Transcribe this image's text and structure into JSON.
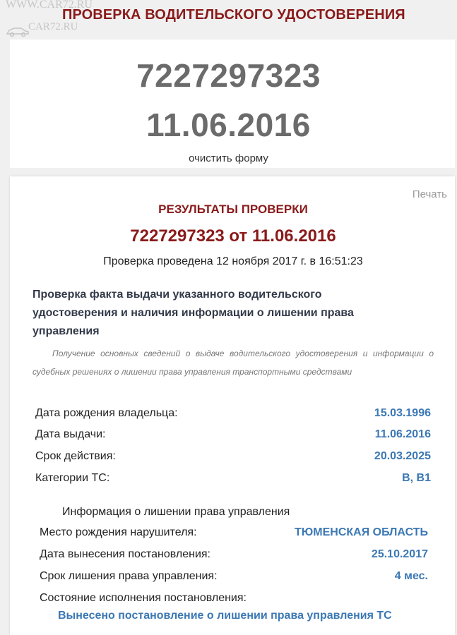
{
  "watermark": {
    "top": "WWW.CAR72.RU",
    "bottom": "CAR72.RU"
  },
  "page_title": "ПРОВЕРКА ВОДИТЕЛЬСКОГО УДОСТОВЕРЕНИЯ",
  "form": {
    "license_number": "7227297323",
    "issue_date": "11.06.2016",
    "clear_label": "очистить форму"
  },
  "results": {
    "print_label": "Печать",
    "title": "РЕЗУЛЬТАТЫ ПРОВЕРКИ",
    "subtitle": "7227297323 от 11.06.2016",
    "check_time": "Проверка проведена 12 ноября 2017 г. в 16:51:23",
    "section_title": "Проверка факта выдачи указанного водительского удостоверения и наличия информации о лишении права управления",
    "section_desc": "Получение основных сведений о выдаче водительского удостоверения и информации о судебных решениях о лишении права управления транспортными средствами",
    "fields": [
      {
        "label": "Дата рождения владельца:",
        "value": "15.03.1996"
      },
      {
        "label": "Дата выдачи:",
        "value": "11.06.2016"
      },
      {
        "label": "Срок действия:",
        "value": "20.03.2025"
      },
      {
        "label": "Категории ТС:",
        "value": "B, B1"
      }
    ],
    "deprivation": {
      "title": "Информация о лишении права управления",
      "fields": [
        {
          "label": "Место рождения нарушителя:",
          "value": "ТЮМЕНСКАЯ ОБЛАСТЬ"
        },
        {
          "label": "Дата вынесения постановления:",
          "value": "25.10.2017"
        },
        {
          "label": "Срок лишения права управления:",
          "value": "4 мес."
        }
      ],
      "state_label": "Состояние исполнения постановления:",
      "state_value": "Вынесено постановление о лишении права управления ТС"
    }
  },
  "colors": {
    "title": "#8a1a1a",
    "value": "#3b78b4",
    "background": "#f0f0f0"
  }
}
